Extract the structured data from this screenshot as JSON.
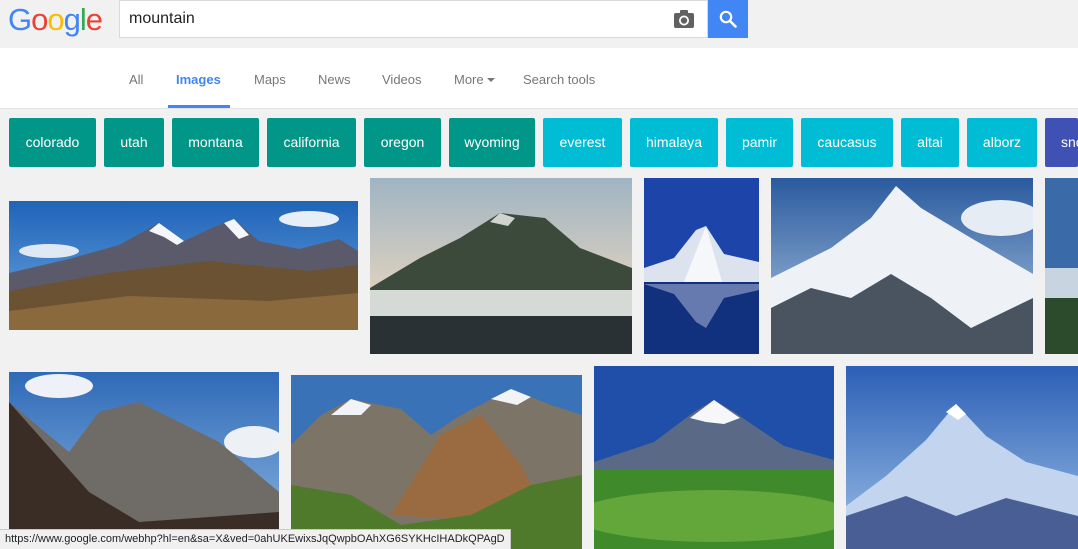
{
  "header": {
    "logo_letters": [
      "G",
      "o",
      "o",
      "g",
      "l",
      "e"
    ],
    "logo_colors": [
      "#4285f4",
      "#ea4335",
      "#fbbc05",
      "#4285f4",
      "#34a853",
      "#ea4335"
    ],
    "search_value": "mountain",
    "camera_icon": "camera-icon",
    "search_icon": "magnifier-icon",
    "accent": "#4285f4"
  },
  "nav": {
    "tabs": [
      {
        "label": "All"
      },
      {
        "label": "Images"
      },
      {
        "label": "Maps"
      },
      {
        "label": "News"
      },
      {
        "label": "Videos"
      },
      {
        "label": "More"
      },
      {
        "label": "Search tools"
      }
    ],
    "active_tab": "Images"
  },
  "chips": [
    {
      "label": "colorado",
      "color": "#009688"
    },
    {
      "label": "utah",
      "color": "#009688"
    },
    {
      "label": "montana",
      "color": "#009688"
    },
    {
      "label": "california",
      "color": "#009688"
    },
    {
      "label": "oregon",
      "color": "#009688"
    },
    {
      "label": "wyoming",
      "color": "#009688"
    },
    {
      "label": "everest",
      "color": "#00bcd4"
    },
    {
      "label": "himalaya",
      "color": "#00bcd4"
    },
    {
      "label": "pamir",
      "color": "#00bcd4"
    },
    {
      "label": "caucasus",
      "color": "#00bcd4"
    },
    {
      "label": "altai",
      "color": "#00bcd4"
    },
    {
      "label": "alborz",
      "color": "#00bcd4"
    },
    {
      "label": "sno",
      "color": "#3f51b5"
    }
  ],
  "images": [
    {
      "name": "mountain-range-panorama"
    },
    {
      "name": "misty-lake-mountain"
    },
    {
      "name": "matterhorn-reflection"
    },
    {
      "name": "snowy-peak-k2"
    },
    {
      "name": "forest-edge-partial"
    },
    {
      "name": "rocky-cliffs"
    },
    {
      "name": "canadian-rockies-valley"
    },
    {
      "name": "taranaki-volcano"
    },
    {
      "name": "blue-snowy-peaks"
    }
  ],
  "status": {
    "url": "https://www.google.com/webhp?hl=en&sa=X&ved=0ahUKEwixsJqQwpbOAhXG6SYKHcIHADkQPAgD"
  }
}
